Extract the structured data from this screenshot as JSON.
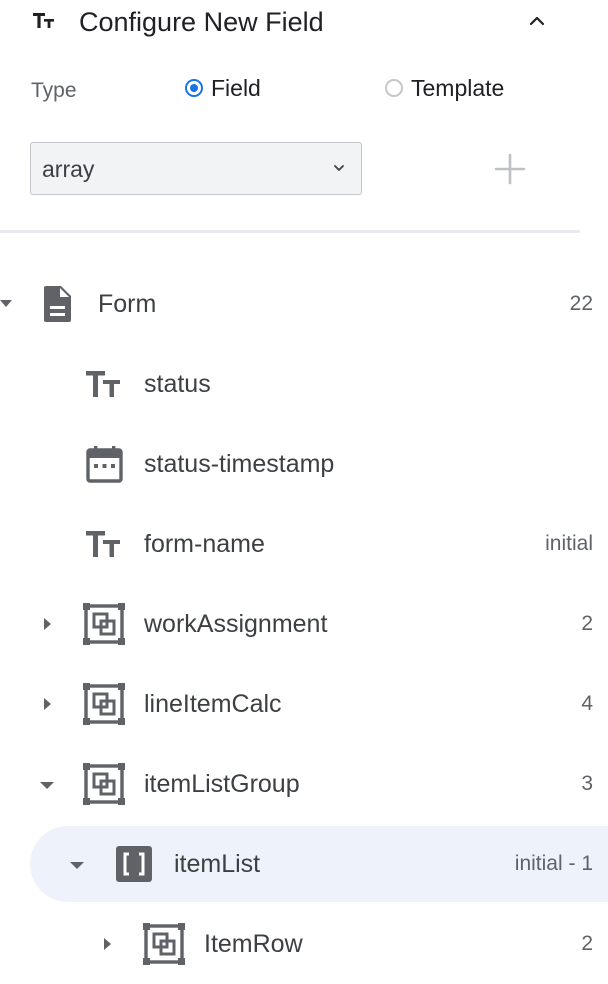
{
  "header": {
    "title": "Configure New Field",
    "collapse_icon": "chevron-up-icon",
    "type_icon": "text-type-icon"
  },
  "type_selector": {
    "label": "Type",
    "options": [
      {
        "label": "Field",
        "checked": true
      },
      {
        "label": "Template",
        "checked": false
      }
    ]
  },
  "select": {
    "value": "array"
  },
  "add_button": {
    "icon": "plus-icon"
  },
  "colors": {
    "accent": "#1a73e8",
    "icon_gray": "#5f6368",
    "selected_bg": "#eef2fb",
    "select_bg": "#f1f3f4"
  },
  "tree": [
    {
      "label": "Form",
      "count": "22",
      "icon": "document-icon",
      "caret": "down"
    },
    {
      "label": "status",
      "count": "",
      "icon": "text-type-icon",
      "caret": "none"
    },
    {
      "label": "status-timestamp",
      "count": "",
      "icon": "calendar-icon",
      "caret": "none"
    },
    {
      "label": "form-name",
      "count": "initial",
      "icon": "text-type-icon",
      "caret": "none"
    },
    {
      "label": "workAssignment",
      "count": "2",
      "icon": "group-icon",
      "caret": "right"
    },
    {
      "label": "lineItemCalc",
      "count": "4",
      "icon": "group-icon",
      "caret": "right"
    },
    {
      "label": "itemListGroup",
      "count": "3",
      "icon": "group-icon",
      "caret": "down"
    },
    {
      "label": "itemList",
      "count": "initial - 1",
      "icon": "array-icon",
      "caret": "down",
      "selected": true
    },
    {
      "label": "ItemRow",
      "count": "2",
      "icon": "group-icon",
      "caret": "right"
    }
  ]
}
